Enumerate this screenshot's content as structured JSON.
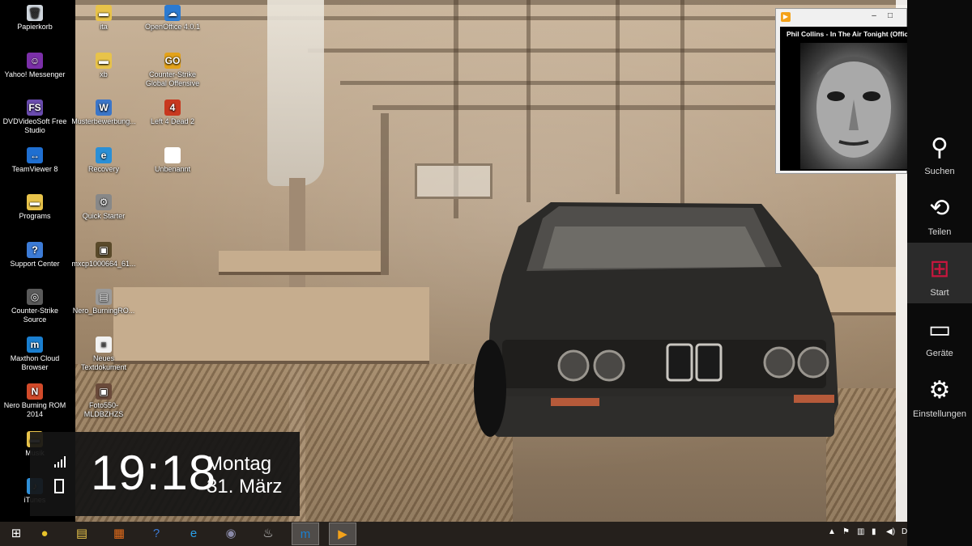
{
  "desktop": {
    "icons_col1": [
      {
        "label": "Papierkorb",
        "icon": "recycle-bin-icon",
        "color": "#cfd6dd",
        "glyph": "🗑"
      },
      {
        "label": "Yahoo! Messenger",
        "icon": "yahoo-messenger-icon",
        "color": "#7b2fa8",
        "glyph": "☺"
      },
      {
        "label": "DVDVideoSoft Free Studio",
        "icon": "dvdvideosoft-icon",
        "color": "#6a4caf",
        "glyph": "FS"
      },
      {
        "label": "TeamViewer 8",
        "icon": "teamviewer-icon",
        "color": "#1f6fd1",
        "glyph": "↔"
      },
      {
        "label": "Programs",
        "icon": "folder-icon",
        "color": "#e8c34a",
        "glyph": "▬"
      },
      {
        "label": "Support Center",
        "icon": "support-center-icon",
        "color": "#3c7bd6",
        "glyph": "?"
      },
      {
        "label": "Counter-Strike Source",
        "icon": "counter-strike-source-icon",
        "color": "#5a5a5a",
        "glyph": "◎"
      },
      {
        "label": "Maxthon Cloud Browser",
        "icon": "maxthon-icon",
        "color": "#1a7fd0",
        "glyph": "m"
      },
      {
        "label": "Nero Burning ROM 2014",
        "icon": "nero-icon",
        "color": "#d24a2a",
        "glyph": "N"
      },
      {
        "label": "Musik",
        "icon": "folder-icon",
        "color": "#e8c34a",
        "glyph": "▬"
      },
      {
        "label": "iTunes",
        "icon": "itunes-icon",
        "color": "#2f8fd8",
        "glyph": "♪"
      }
    ],
    "icons_col2": [
      {
        "label": "ita",
        "icon": "folder-icon",
        "color": "#e8c34a",
        "glyph": "▬"
      },
      {
        "label": "xb",
        "icon": "folder-icon",
        "color": "#e8c34a",
        "glyph": "▬"
      },
      {
        "label": "Musterbewerbung...",
        "icon": "document-icon",
        "color": "#3b76c9",
        "glyph": "W"
      },
      {
        "label": "Recovery",
        "icon": "recovery-icon",
        "color": "#2a8fd6",
        "glyph": "e"
      },
      {
        "label": "Quick Starter",
        "icon": "quick-starter-icon",
        "color": "#888888",
        "glyph": "⚙"
      },
      {
        "label": "mxcp1000664_61...",
        "icon": "image-icon",
        "color": "#5a4a2a",
        "glyph": "▣"
      },
      {
        "label": "Nero_BurningRO...",
        "icon": "installer-icon",
        "color": "#9a9a9a",
        "glyph": "▤"
      },
      {
        "label": "Neues Textdokument",
        "icon": "text-document-icon",
        "color": "#f2f2f2",
        "glyph": "≡"
      },
      {
        "label": "Foto550-MLDBZHZS",
        "icon": "image-icon",
        "color": "#6a4a3a",
        "glyph": "▣"
      }
    ],
    "icons_col3": [
      {
        "label": "OpenOffice 4.0.1",
        "icon": "openoffice-icon",
        "color": "#2b7ad1",
        "glyph": "☁"
      },
      {
        "label": "Counter-Strike Global Offensive",
        "icon": "csgo-icon",
        "color": "#e3a21a",
        "glyph": "GO"
      },
      {
        "label": "Left 4 Dead 2",
        "icon": "left4dead-icon",
        "color": "#c8381f",
        "glyph": "4"
      },
      {
        "label": "Unbenannt",
        "icon": "blank-document-icon",
        "color": "#ffffff",
        "glyph": ""
      }
    ]
  },
  "player": {
    "track": "Phil Collins - In The Air Tonight (Offic",
    "minimize": "‒",
    "maximize": "□"
  },
  "charms": [
    {
      "label": "Suchen",
      "icon": "search-icon",
      "glyph": "⚲"
    },
    {
      "label": "Teilen",
      "icon": "share-icon",
      "glyph": "⟲"
    },
    {
      "label": "Start",
      "icon": "windows-logo-icon",
      "glyph": "⊞",
      "active": true,
      "color": "#c8163e"
    },
    {
      "label": "Geräte",
      "icon": "devices-icon",
      "glyph": "▭"
    },
    {
      "label": "Einstellungen",
      "icon": "settings-gear-icon",
      "glyph": "⚙"
    }
  ],
  "clock": {
    "time": "19:18",
    "day": "Montag",
    "date": "31. März"
  },
  "taskbar": {
    "items": [
      {
        "name": "start-button",
        "glyph": "⊞",
        "color": "#ffffff"
      },
      {
        "name": "chrome-taskbar-button",
        "glyph": "●",
        "color": "#e8c32a"
      },
      {
        "name": "file-explorer-taskbar-button",
        "glyph": "▤",
        "color": "#e8c34a"
      },
      {
        "name": "office-taskbar-button",
        "glyph": "▦",
        "color": "#e06a1a"
      },
      {
        "name": "help-taskbar-button",
        "glyph": "?",
        "color": "#3c7bd6"
      },
      {
        "name": "internet-explorer-taskbar-button",
        "glyph": "e",
        "color": "#2a9fe8"
      },
      {
        "name": "media-center-taskbar-button",
        "glyph": "◉",
        "color": "#8a8aa8"
      },
      {
        "name": "steam-taskbar-button",
        "glyph": "♨",
        "color": "#cfcfcf"
      },
      {
        "name": "maxthon-taskbar-button",
        "glyph": "m",
        "color": "#1a7fd0",
        "active": true
      },
      {
        "name": "media-player-taskbar-button",
        "glyph": "▶",
        "color": "#f4a21a",
        "active": true
      }
    ],
    "tray_text": "D"
  }
}
